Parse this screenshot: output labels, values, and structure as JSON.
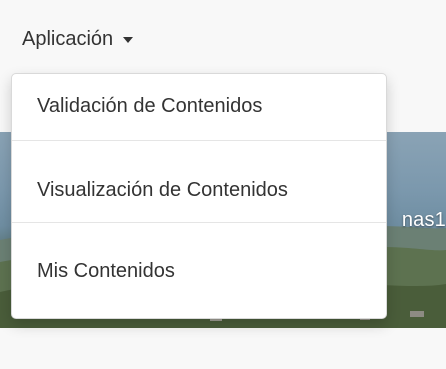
{
  "navbar": {
    "menu_label": "Aplicación"
  },
  "dropdown": {
    "items": [
      {
        "label": "Validación de Contenidos"
      },
      {
        "label": "Visualización de Contenidos"
      },
      {
        "label": "Mis Contenidos"
      }
    ]
  },
  "banner": {
    "partial_text": "nas1"
  },
  "icons": {
    "caret": "caret-down-icon"
  }
}
